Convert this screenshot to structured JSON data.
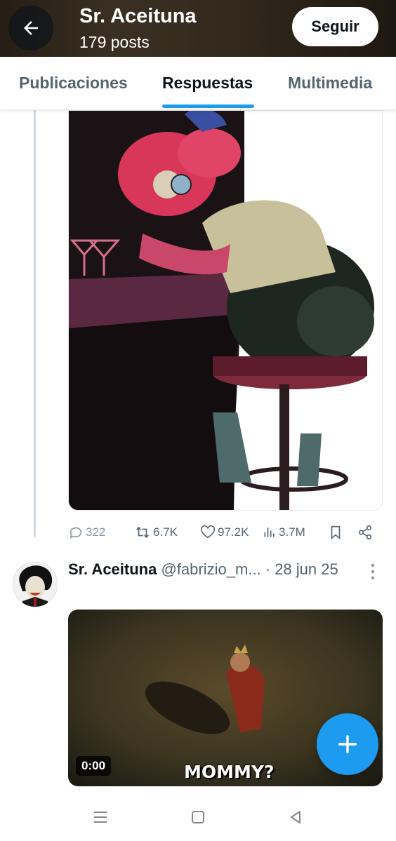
{
  "header": {
    "title": "Sr. Aceituna",
    "subtitle": "179 posts",
    "follow_label": "Seguir",
    "back_icon": "arrow-left-icon"
  },
  "tabs": [
    {
      "label": "Publicaciones",
      "active": false
    },
    {
      "label": "Respuestas",
      "active": true
    },
    {
      "label": "Multimedia",
      "active": false
    }
  ],
  "post1": {
    "stats": {
      "replies": "322",
      "reposts": "6.7K",
      "likes": "97.2K",
      "views": "3.7M"
    }
  },
  "post2": {
    "author_name": "Sr. Aceituna",
    "handle": "@fabrizio_m...",
    "date": "· 28 jun 25",
    "video": {
      "duration": "0:00",
      "caption": "MOMMY?"
    }
  },
  "colors": {
    "accent": "#1d9bf0",
    "text": "#0f1419",
    "muted": "#536471"
  }
}
